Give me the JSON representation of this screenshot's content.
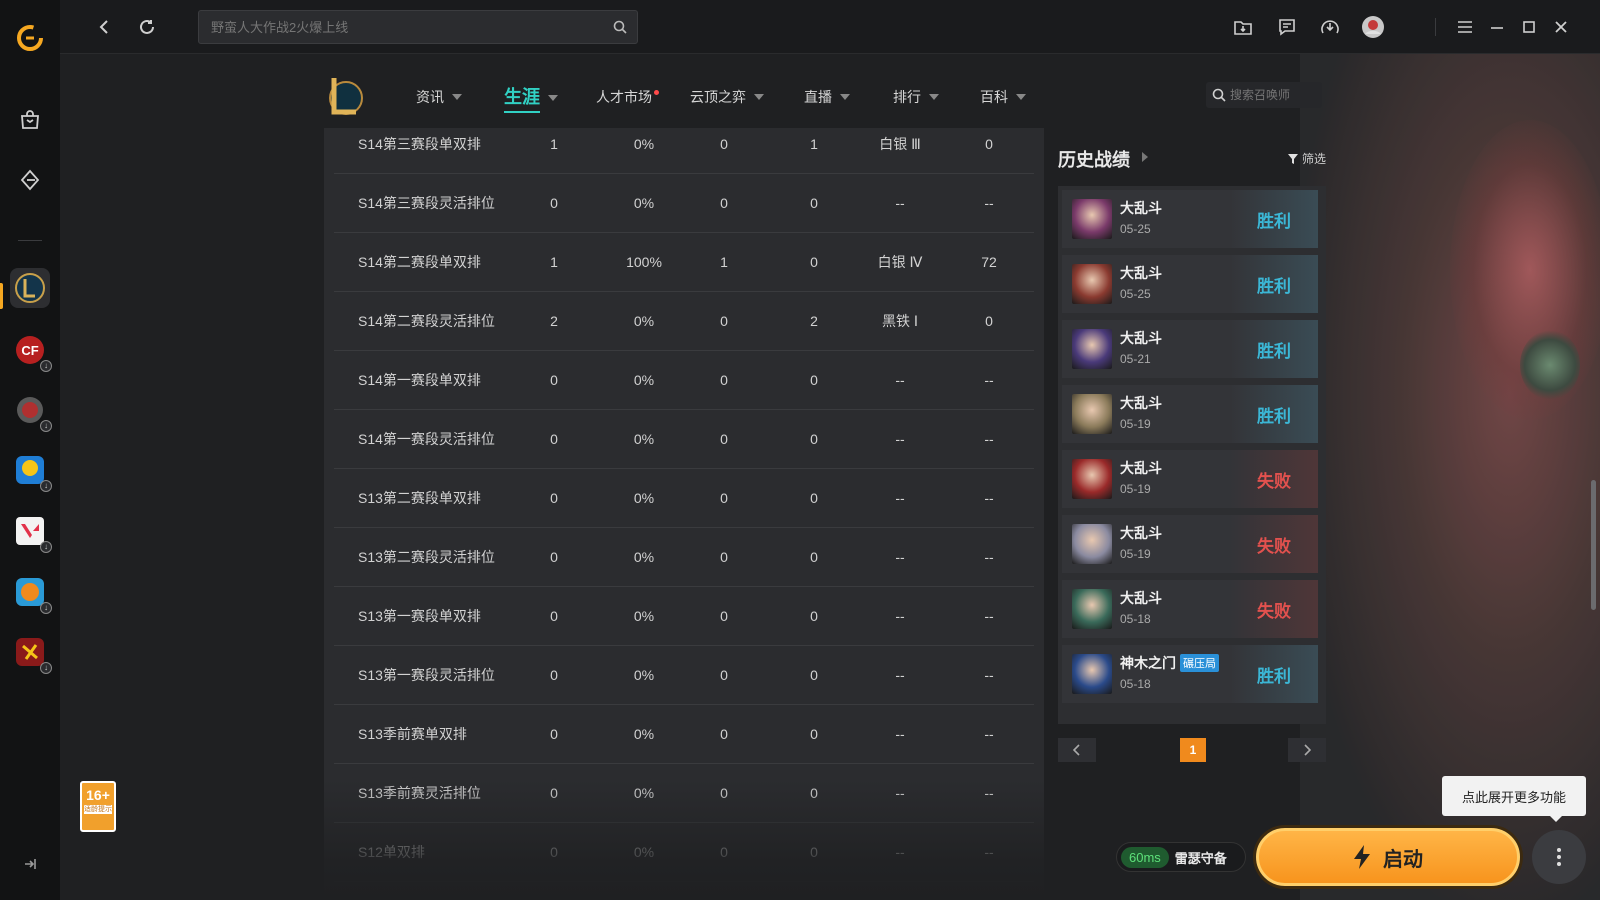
{
  "search": {
    "placeholder": "野蛮人大作战2火爆上线"
  },
  "nav": {
    "items": [
      {
        "label": "资讯"
      },
      {
        "label": "生涯"
      },
      {
        "label": "人才市场"
      },
      {
        "label": "云顶之弈"
      },
      {
        "label": "直播"
      },
      {
        "label": "排行"
      },
      {
        "label": "百科"
      }
    ],
    "active": "生涯",
    "summoner_search_placeholder": "搜索召唤师"
  },
  "table": {
    "rows": [
      [
        "S14第三赛段单双排",
        "1",
        "0%",
        "0",
        "1",
        "白银 Ⅲ",
        "0"
      ],
      [
        "S14第三赛段灵活排位",
        "0",
        "0%",
        "0",
        "0",
        "--",
        "--"
      ],
      [
        "S14第二赛段单双排",
        "1",
        "100%",
        "1",
        "0",
        "白银 Ⅳ",
        "72"
      ],
      [
        "S14第二赛段灵活排位",
        "2",
        "0%",
        "0",
        "2",
        "黑铁 Ⅰ",
        "0"
      ],
      [
        "S14第一赛段单双排",
        "0",
        "0%",
        "0",
        "0",
        "--",
        "--"
      ],
      [
        "S14第一赛段灵活排位",
        "0",
        "0%",
        "0",
        "0",
        "--",
        "--"
      ],
      [
        "S13第二赛段单双排",
        "0",
        "0%",
        "0",
        "0",
        "--",
        "--"
      ],
      [
        "S13第二赛段灵活排位",
        "0",
        "0%",
        "0",
        "0",
        "--",
        "--"
      ],
      [
        "S13第一赛段单双排",
        "0",
        "0%",
        "0",
        "0",
        "--",
        "--"
      ],
      [
        "S13第一赛段灵活排位",
        "0",
        "0%",
        "0",
        "0",
        "--",
        "--"
      ],
      [
        "S13季前赛单双排",
        "0",
        "0%",
        "0",
        "0",
        "--",
        "--"
      ],
      [
        "S13季前赛灵活排位",
        "0",
        "0%",
        "0",
        "0",
        "--",
        "--"
      ],
      [
        "S12单双排",
        "0",
        "0%",
        "0",
        "0",
        "--",
        "--"
      ]
    ]
  },
  "history": {
    "title": "历史战绩",
    "filter_label": "筛选",
    "matches": [
      {
        "mode": "大乱斗",
        "date": "05-25",
        "result": "胜利",
        "win": true,
        "color": "#7a3a6a"
      },
      {
        "mode": "大乱斗",
        "date": "05-25",
        "result": "胜利",
        "win": true,
        "color": "#8a3a30"
      },
      {
        "mode": "大乱斗",
        "date": "05-21",
        "result": "胜利",
        "win": true,
        "color": "#4a3a7a"
      },
      {
        "mode": "大乱斗",
        "date": "05-19",
        "result": "胜利",
        "win": true,
        "color": "#8a7a5a"
      },
      {
        "mode": "大乱斗",
        "date": "05-19",
        "result": "失败",
        "win": false,
        "color": "#9a2a2a"
      },
      {
        "mode": "大乱斗",
        "date": "05-19",
        "result": "失败",
        "win": false,
        "color": "#8a8aa0"
      },
      {
        "mode": "大乱斗",
        "date": "05-18",
        "result": "失败",
        "win": false,
        "color": "#3a6a5a"
      },
      {
        "mode": "神木之门",
        "tag": "碾压局",
        "date": "05-18",
        "result": "胜利",
        "win": true,
        "color": "#2a4a8a"
      }
    ],
    "page": "1"
  },
  "age_rating": {
    "number": "16+",
    "text": "适龄提示"
  },
  "bottom": {
    "tooltip": "点此展开更多功能",
    "ping": "60ms",
    "server": "雷瑟守备",
    "launch_label": "启动"
  },
  "colors": {
    "accent_teal": "#31d1c4",
    "win": "#3bb7d6",
    "loss": "#e2514e",
    "launch": "#f7941d"
  }
}
